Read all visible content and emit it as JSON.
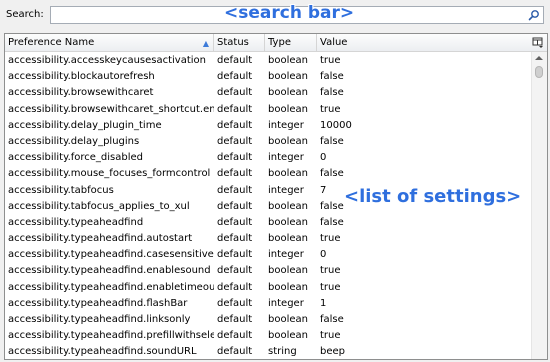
{
  "search": {
    "label": "Search:",
    "value": "",
    "placeholder": ""
  },
  "annotations": {
    "search_bar": "<search bar>",
    "settings_list": "<list of settings>"
  },
  "columns": {
    "name": "Preference Name",
    "status": "Status",
    "type": "Type",
    "value": "Value"
  },
  "rows": [
    {
      "name": "accessibility.accesskeycausesactivation",
      "status": "default",
      "type": "boolean",
      "value": "true"
    },
    {
      "name": "accessibility.blockautorefresh",
      "status": "default",
      "type": "boolean",
      "value": "false"
    },
    {
      "name": "accessibility.browsewithcaret",
      "status": "default",
      "type": "boolean",
      "value": "false"
    },
    {
      "name": "accessibility.browsewithcaret_shortcut.en...",
      "status": "default",
      "type": "boolean",
      "value": "true"
    },
    {
      "name": "accessibility.delay_plugin_time",
      "status": "default",
      "type": "integer",
      "value": "10000"
    },
    {
      "name": "accessibility.delay_plugins",
      "status": "default",
      "type": "boolean",
      "value": "false"
    },
    {
      "name": "accessibility.force_disabled",
      "status": "default",
      "type": "integer",
      "value": "0"
    },
    {
      "name": "accessibility.mouse_focuses_formcontrol",
      "status": "default",
      "type": "boolean",
      "value": "false"
    },
    {
      "name": "accessibility.tabfocus",
      "status": "default",
      "type": "integer",
      "value": "7"
    },
    {
      "name": "accessibility.tabfocus_applies_to_xul",
      "status": "default",
      "type": "boolean",
      "value": "false"
    },
    {
      "name": "accessibility.typeaheadfind",
      "status": "default",
      "type": "boolean",
      "value": "false"
    },
    {
      "name": "accessibility.typeaheadfind.autostart",
      "status": "default",
      "type": "boolean",
      "value": "true"
    },
    {
      "name": "accessibility.typeaheadfind.casesensitive",
      "status": "default",
      "type": "integer",
      "value": "0"
    },
    {
      "name": "accessibility.typeaheadfind.enablesound",
      "status": "default",
      "type": "boolean",
      "value": "true"
    },
    {
      "name": "accessibility.typeaheadfind.enabletimeout",
      "status": "default",
      "type": "boolean",
      "value": "true"
    },
    {
      "name": "accessibility.typeaheadfind.flashBar",
      "status": "default",
      "type": "integer",
      "value": "1"
    },
    {
      "name": "accessibility.typeaheadfind.linksonly",
      "status": "default",
      "type": "boolean",
      "value": "false"
    },
    {
      "name": "accessibility.typeaheadfind.prefillwithsele...",
      "status": "default",
      "type": "boolean",
      "value": "true"
    },
    {
      "name": "accessibility.typeaheadfind.soundURL",
      "status": "default",
      "type": "string",
      "value": "beep"
    }
  ]
}
